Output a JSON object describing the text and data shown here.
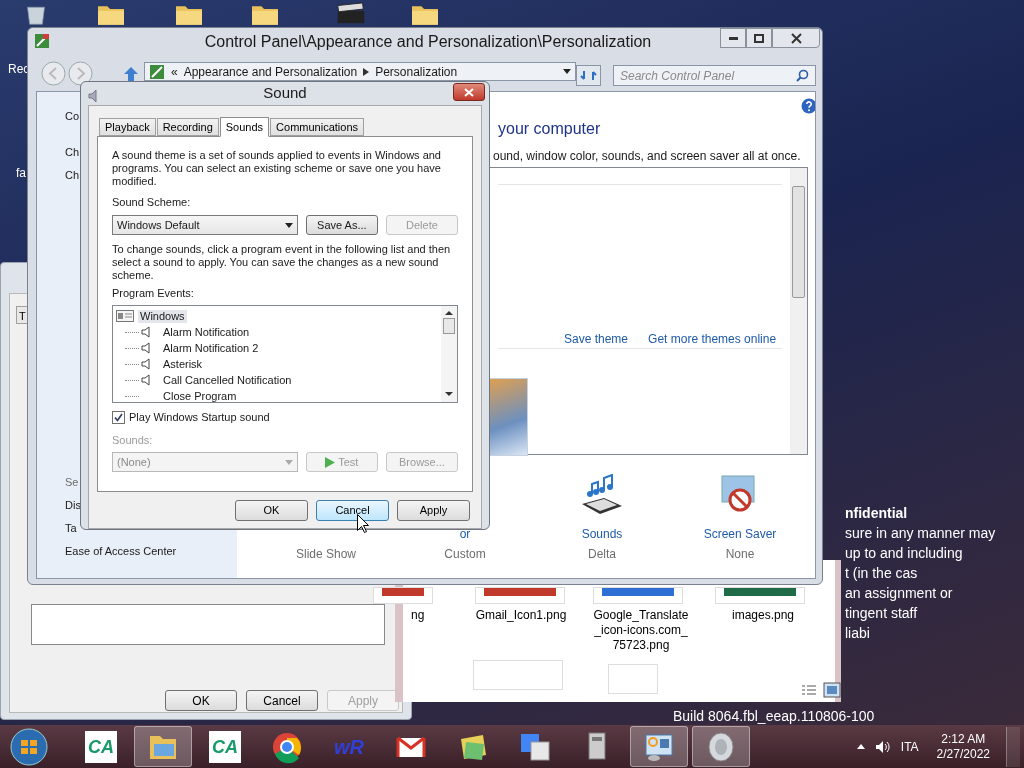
{
  "desktop": {
    "icon_labels": [
      "Rec",
      "fa"
    ],
    "notice_lines": [
      {
        "text": "nfidential",
        "bold": true
      },
      {
        "text": "sure in any manner may",
        "bold": false
      },
      {
        "text": "up to and including",
        "bold": false
      },
      {
        "text": "t (in the cas",
        "bold": false
      },
      {
        "text": "an assignment or",
        "bold": false
      },
      {
        "text": "tingent staff",
        "bold": false
      },
      {
        "text": "liabi",
        "bold": false
      }
    ],
    "build": "Build 8064.fbl_eeap.110806-100"
  },
  "back_dialog": {
    "tab": "T",
    "buttons": [
      {
        "label": "OK",
        "disabled": false
      },
      {
        "label": "Cancel",
        "disabled": false
      },
      {
        "label": "Apply",
        "disabled": true
      }
    ]
  },
  "explorer": {
    "files": [
      "ng",
      "Gmail_Icon1.png",
      "Google_Translate_icon-icons.com_75723.png",
      "images.png"
    ]
  },
  "control_panel": {
    "title": "Control Panel\\Appearance and Personalization\\Personalization",
    "breadcrumbs": [
      "«",
      "Appearance and Personalization",
      "Personalization"
    ],
    "search_placeholder": "Search Control Panel",
    "left_links": [
      "Co",
      "Ch",
      "Ch",
      "Se",
      "Dis",
      "Ta",
      "Ease of Access Center"
    ],
    "heading": "your computer",
    "description": "ound, window color, sounds, and screen saver all at once.",
    "theme_links": [
      "Save theme",
      "Get more themes online"
    ],
    "settings": [
      {
        "kind": "background",
        "value": "Slide Show"
      },
      {
        "kind": "color",
        "label": "or",
        "value": "Custom"
      },
      {
        "kind": "sounds",
        "label": "Sounds",
        "value": "Delta"
      },
      {
        "kind": "screensaver",
        "label": "Screen Saver",
        "value": "None"
      }
    ]
  },
  "sound_dialog": {
    "title": "Sound",
    "tabs": [
      {
        "label": "Playback",
        "selected": false
      },
      {
        "label": "Recording",
        "selected": false
      },
      {
        "label": "Sounds",
        "selected": true
      },
      {
        "label": "Communications",
        "selected": false
      }
    ],
    "description": "A sound theme is a set of sounds applied to events in Windows and programs.  You can select an existing scheme or save one you have modified.",
    "scheme_label": "Sound Scheme:",
    "scheme_value": "Windows Default",
    "scheme_buttons": [
      {
        "label": "Save As...",
        "disabled": false
      },
      {
        "label": "Delete",
        "disabled": true
      }
    ],
    "instructions": "To change sounds, click a program event in the following list and then select a sound to apply.  You can save the changes as a new sound scheme.",
    "events_label": "Program Events:",
    "events": [
      {
        "label": "Windows",
        "selected": true,
        "children": [
          {
            "label": "Alarm Notification",
            "has_sound": true,
            "selected": false
          },
          {
            "label": "Alarm Notification 2",
            "has_sound": true,
            "selected": false
          },
          {
            "label": "Asterisk",
            "has_sound": true,
            "selected": false
          },
          {
            "label": "Call Cancelled Notification",
            "has_sound": true,
            "selected": false
          },
          {
            "label": "Close Program",
            "has_sound": false,
            "selected": false
          }
        ]
      }
    ],
    "startup": {
      "label": "Play Windows Startup sound",
      "checked": true
    },
    "sounds_label": "Sounds:",
    "sounds_value": "(None)",
    "sounds_disabled": true,
    "test_label": "Test",
    "browse_label": "Browse...",
    "buttons": [
      {
        "label": "OK",
        "hovered": false
      },
      {
        "label": "Cancel",
        "hovered": true
      },
      {
        "label": "Apply",
        "hovered": false
      }
    ]
  },
  "taskbar": {
    "apps": [
      {
        "kind": "ca",
        "label": "CA",
        "selected": false
      },
      {
        "kind": "explorer",
        "selected": true
      },
      {
        "kind": "ca",
        "label": "CA",
        "selected": false
      },
      {
        "kind": "chrome",
        "selected": false
      },
      {
        "kind": "wr",
        "label": "wR",
        "selected": false
      },
      {
        "kind": "gmail",
        "selected": false
      },
      {
        "kind": "folder",
        "selected": false
      },
      {
        "kind": "translate",
        "selected": false
      },
      {
        "kind": "device",
        "selected": false
      },
      {
        "kind": "controlpanel",
        "selected": true
      },
      {
        "kind": "sound",
        "selected": true
      }
    ],
    "language": "ITA",
    "time": "2:12 AM",
    "date": "2/27/2022"
  }
}
